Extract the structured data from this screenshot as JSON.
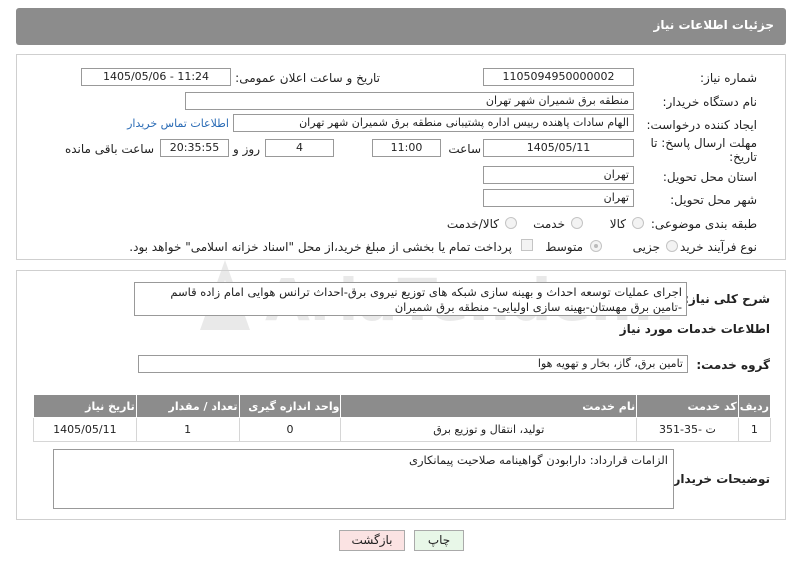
{
  "header": {
    "title": "جزئیات اطلاعات نیاز"
  },
  "form": {
    "need_number_label": "شماره نیاز:",
    "need_number": "1105094950000002",
    "announce_label": "تاریخ و ساعت اعلان عمومی:",
    "announce_value": "1405/05/06 - 11:24",
    "buyer_org_label": "نام دستگاه خریدار:",
    "buyer_org": "منطقه برق شمیران شهر تهران",
    "requester_label": "ایجاد کننده درخواست:",
    "requester": "الهام سادات پاهنده رییس اداره پشتیبانی منطقه برق شمیران شهر تهران",
    "contact_link": "اطلاعات تماس خریدار",
    "deadline_label": "مهلت ارسال پاسخ: تا تاریخ:",
    "deadline_date": "1405/05/11",
    "time_label": "ساعت",
    "deadline_time": "11:00",
    "days_value": "4",
    "days_label": "روز و",
    "remaining_time": "20:35:55",
    "remaining_label": "ساعت باقی مانده",
    "province_label": "استان محل تحویل:",
    "province": "تهران",
    "city_label": "شهر محل تحویل:",
    "city": "تهران",
    "category_label": "طبقه بندی موضوعی:",
    "category_options": [
      "کالا",
      "خدمت",
      "کالا/خدمت"
    ],
    "process_label": "نوع فرآیند خرید :",
    "process_options": [
      "جزیی",
      "متوسط"
    ],
    "payment_note": "پرداخت تمام یا بخشی از مبلغ خرید،از محل \"اسناد خزانه اسلامی\" خواهد بود."
  },
  "details": {
    "description_label": "شرح کلی نیاز:",
    "description": "اجرای عملیات توسعه احداث و بهینه سازی شبکه های توزیع نیروی برق-احداث ترانس هوایی امام زاده قاسم -تامین برق مهستان-بهینه سازی اولیایی- منطقه برق شمیران",
    "services_info_title": "اطلاعات خدمات مورد نیاز",
    "service_group_label": "گروه خدمت:",
    "service_group": "تامین برق، گاز، بخار و تهویه هوا",
    "table": {
      "headers": [
        "ردیف",
        "کد خدمت",
        "نام خدمت",
        "واحد اندازه گیری",
        "تعداد / مقدار",
        "تاریخ نیاز"
      ],
      "rows": [
        [
          "1",
          "ت -35-351",
          "تولید، انتقال و توزیع برق",
          "0",
          "1",
          "1405/05/11"
        ]
      ]
    },
    "buyer_notes_label": "توضیحات خریدار:",
    "buyer_notes": "الزامات قرارداد: دارابودن گواهینامه صلاحیت پیمانکاری"
  },
  "buttons": {
    "print": "چاپ",
    "back": "بازگشت"
  },
  "watermark_text": "AriaTender.neT",
  "colors": {
    "header_bg": "#8c8c8c",
    "link": "#2a6bb5",
    "print_btn": "#e8f7e8",
    "back_btn": "#fbe3e3"
  }
}
